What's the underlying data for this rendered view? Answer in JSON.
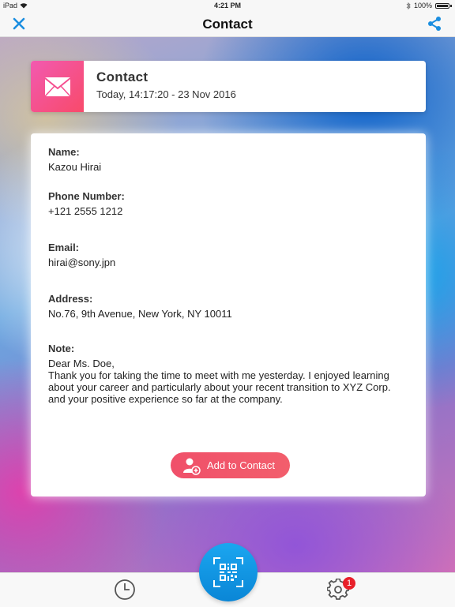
{
  "status_bar": {
    "carrier": "iPad",
    "time": "4:21 PM",
    "battery": "100%"
  },
  "nav": {
    "title": "Contact"
  },
  "header": {
    "title": "Contact",
    "timestamp": "Today, 14:17:20 - 23 Nov 2016"
  },
  "fields": {
    "name": {
      "label": "Name:",
      "value": "Kazou Hirai"
    },
    "phone": {
      "label": "Phone Number:",
      "value": "+121 2555 1212"
    },
    "email": {
      "label": "Email:",
      "value": "hirai@sony.jpn"
    },
    "address": {
      "label": "Address:",
      "value": "No.76, 9th Avenue, New York,  NY 10011"
    },
    "note": {
      "label": "Note:",
      "lines": [
        "Dear Ms. Doe,",
        "Thank you for taking the time to meet with me yesterday. I enjoyed learning",
        "about your career and particularly about your recent transition to XYZ Corp.",
        "and your positive experience so far at the company."
      ]
    }
  },
  "actions": {
    "add_contact_label": "Add to Contact"
  },
  "tabbar": {
    "settings_badge": "1"
  },
  "colors": {
    "accent": "#1b8ee0",
    "action": "#f0506a",
    "badge": "#e8202a"
  },
  "icons": {
    "close": "close-icon",
    "share": "share-icon",
    "mail": "envelope-icon",
    "add_contact": "add-person-icon",
    "history": "clock-icon",
    "scan": "qr-code-icon",
    "settings": "gear-icon"
  }
}
